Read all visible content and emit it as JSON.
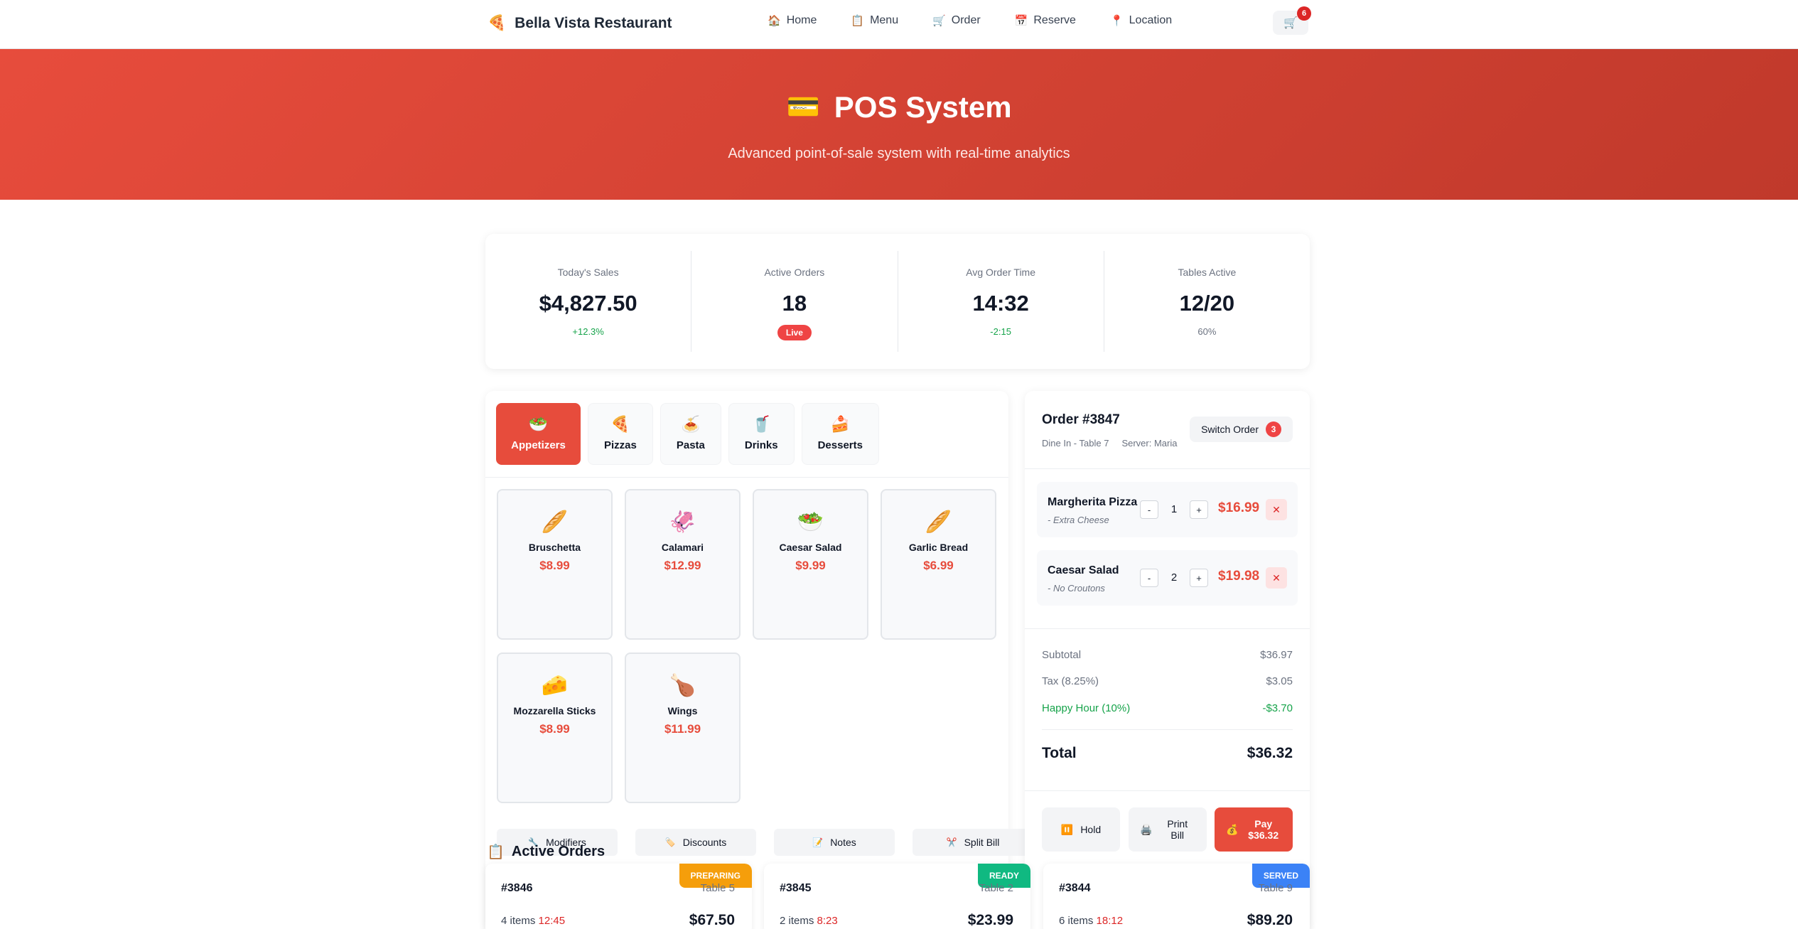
{
  "nav": {
    "brand": "Bella Vista Restaurant",
    "brand_icon": "🍕",
    "links": [
      {
        "icon": "🏠",
        "label": "Home"
      },
      {
        "icon": "📋",
        "label": "Menu"
      },
      {
        "icon": "🛒",
        "label": "Order"
      },
      {
        "icon": "📅",
        "label": "Reserve"
      },
      {
        "icon": "📍",
        "label": "Location"
      }
    ],
    "cart_icon": "🛒",
    "cart_count": "6"
  },
  "hero": {
    "icon": "💳",
    "title": "POS System",
    "subtitle": "Advanced point-of-sale system with real-time analytics"
  },
  "stats": [
    {
      "label": "Today's Sales",
      "value": "$4,827.50",
      "delta": "+12.3%",
      "tone": "positive"
    },
    {
      "label": "Active Orders",
      "value": "18",
      "pill": "Live"
    },
    {
      "label": "Avg Order Time",
      "value": "14:32",
      "delta": "-2:15",
      "tone": "positive"
    },
    {
      "label": "Tables Active",
      "value": "12/20",
      "delta": "60%",
      "tone": "neutral"
    }
  ],
  "categories": [
    {
      "icon": "🥗",
      "label": "Appetizers",
      "active": true
    },
    {
      "icon": "🍕",
      "label": "Pizzas"
    },
    {
      "icon": "🍝",
      "label": "Pasta"
    },
    {
      "icon": "🥤",
      "label": "Drinks"
    },
    {
      "icon": "🍰",
      "label": "Desserts"
    }
  ],
  "menu_items": [
    {
      "icon": "🥖",
      "name": "Bruschetta",
      "price": "$8.99"
    },
    {
      "icon": "🦑",
      "name": "Calamari",
      "price": "$12.99"
    },
    {
      "icon": "🥗",
      "name": "Caesar Salad",
      "price": "$9.99"
    },
    {
      "icon": "🥖",
      "name": "Garlic Bread",
      "price": "$6.99"
    },
    {
      "icon": "🧀",
      "name": "Mozzarella Sticks",
      "price": "$8.99"
    },
    {
      "icon": "🍗",
      "name": "Wings",
      "price": "$11.99"
    }
  ],
  "tools": [
    {
      "icon": "🔧",
      "label": "Modifiers"
    },
    {
      "icon": "🏷️",
      "label": "Discounts"
    },
    {
      "icon": "📝",
      "label": "Notes"
    },
    {
      "icon": "✂️",
      "label": "Split Bill"
    }
  ],
  "order": {
    "id": "Order #3847",
    "type": "Dine In - Table 7",
    "server": "Server: Maria",
    "switch_label": "Switch Order",
    "switch_count": "3",
    "lines": [
      {
        "name": "Margherita Pizza",
        "modifier": "- Extra Cheese",
        "qty": "1",
        "price": "$16.99"
      },
      {
        "name": "Caesar Salad",
        "modifier": "- No Croutons",
        "qty": "2",
        "price": "$19.98"
      }
    ],
    "minus": "-",
    "plus": "+",
    "remove": "✕",
    "subtotal_label": "Subtotal",
    "subtotal": "$36.97",
    "tax_label": "Tax (8.25%)",
    "tax": "$3.05",
    "discount_label": "Happy Hour (10%)",
    "discount": "-$3.70",
    "total_label": "Total",
    "total": "$36.32",
    "actions": {
      "hold_icon": "⏸️",
      "hold": "Hold",
      "print_icon": "🖨️",
      "print": "Print Bill",
      "pay_icon": "💰",
      "pay": "Pay $36.32"
    }
  },
  "active_orders": {
    "icon": "📋",
    "heading": "Active Orders",
    "cards": [
      {
        "num": "#3846",
        "table": "Table 5",
        "status": "PREPARING",
        "status_color": "#f59e0b",
        "items": "4 items",
        "time": "12:45",
        "total": "$67.50"
      },
      {
        "num": "#3845",
        "table": "Table 2",
        "status": "READY",
        "status_color": "#10b981",
        "items": "2 items",
        "time": "8:23",
        "total": "$23.99"
      },
      {
        "num": "#3844",
        "table": "Table 9",
        "status": "SERVED",
        "status_color": "#3b82f6",
        "items": "6 items",
        "time": "18:12",
        "total": "$89.20"
      }
    ]
  }
}
